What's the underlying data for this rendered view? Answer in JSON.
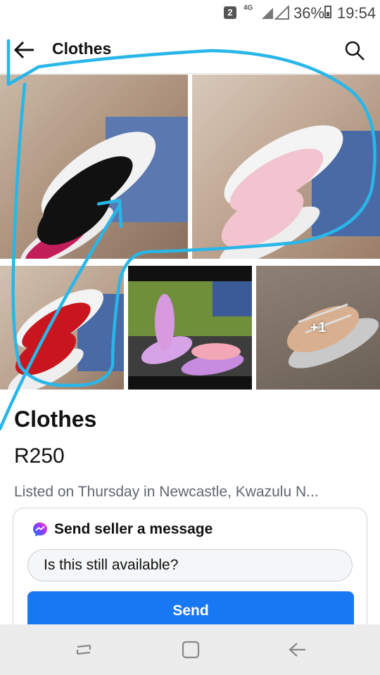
{
  "status_bar": {
    "sim_badge": "2",
    "network": "4G",
    "battery": "36%",
    "time": "19:54"
  },
  "header": {
    "title": "Clothes",
    "back_icon": "arrow-left-icon",
    "search_icon": "search-icon"
  },
  "gallery": {
    "photos": [
      {
        "description_icon": "photo"
      },
      {
        "description_icon": "photo"
      },
      {
        "description_icon": "photo"
      },
      {
        "description_icon": "photo"
      },
      {
        "description_icon": "photo"
      }
    ],
    "more_count": "+1"
  },
  "listing": {
    "title": "Clothes",
    "price": "R250",
    "listed_info": "Listed on Thursday in Newcastle, Kwazulu N..."
  },
  "message_card": {
    "heading": "Send seller a message",
    "icon": "messenger-icon",
    "input_value": "Is this still available?",
    "send_label": "Send"
  },
  "colors": {
    "accent": "#1877f2",
    "annotation": "#29b6e8"
  }
}
